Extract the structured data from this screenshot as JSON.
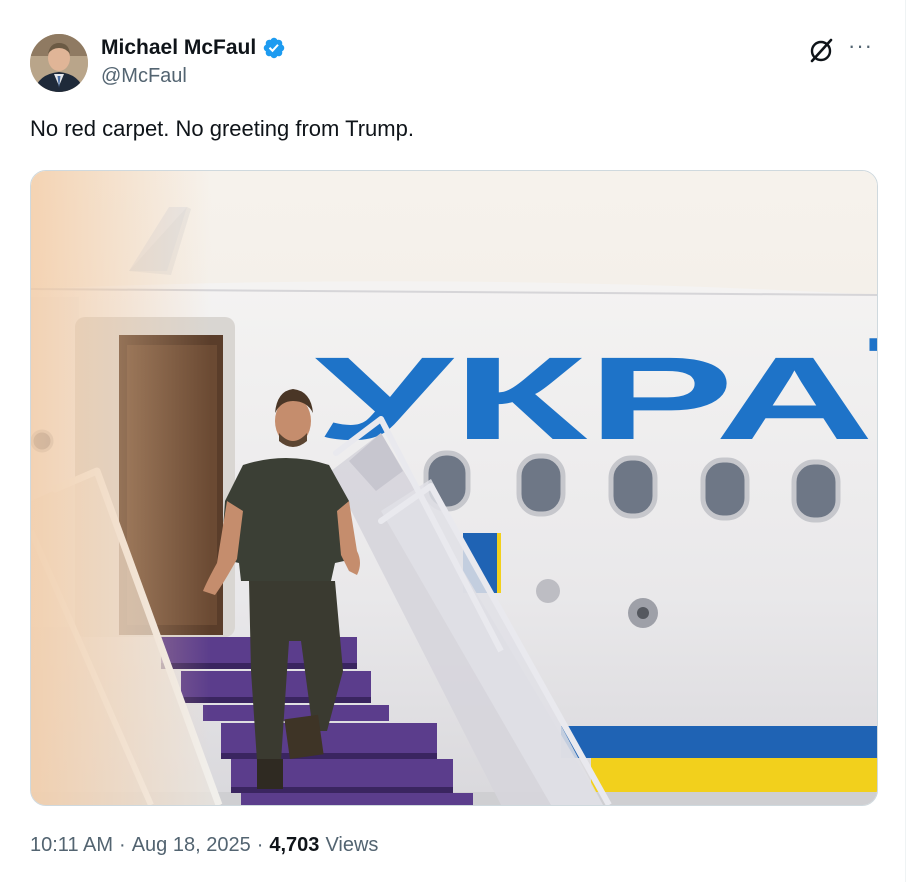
{
  "author": {
    "name": "Michael McFaul",
    "handle": "@McFaul",
    "verified": true
  },
  "tweet": {
    "text": "No red carpet. No greeting from Trump.",
    "time": "10:11 AM",
    "date": "Aug 18, 2025",
    "views_count": "4,703",
    "views_label": "Views"
  },
  "media": {
    "plane_lettering": "УКРАЇ"
  },
  "colors": {
    "verified": "#1d9bf0",
    "plane_blue": "#1e73c8",
    "stripe_blue": "#1f63b4",
    "stripe_yellow": "#f2d01c",
    "secondary_text": "#536471"
  },
  "icons": {
    "verified": "verified-badge-icon",
    "grok": "grok-icon",
    "more": "more-icon"
  }
}
